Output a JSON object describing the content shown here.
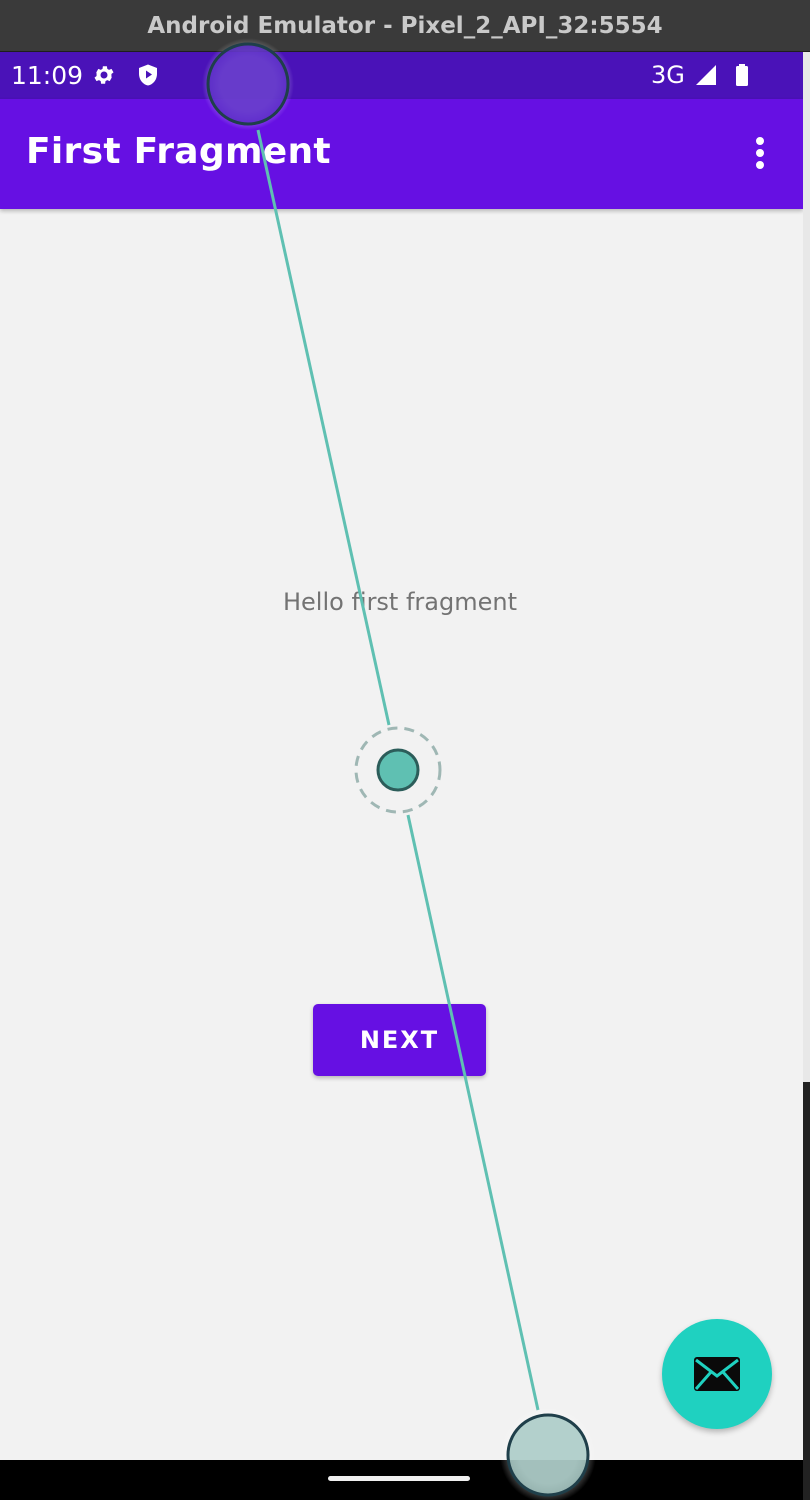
{
  "window": {
    "title": "Android Emulator - Pixel_2_API_32:5554"
  },
  "status_bar": {
    "time": "11:09",
    "network": "3G",
    "icons": [
      "settings-icon",
      "shield-play-icon",
      "signal-icon",
      "battery-icon"
    ]
  },
  "app_bar": {
    "title": "First Fragment",
    "menu_icon": "more-vert-icon"
  },
  "content": {
    "hello_text": "Hello first fragment",
    "next_label": "NEXT"
  },
  "fab": {
    "icon": "email-icon"
  },
  "colors": {
    "status_bar": "#4a12b8",
    "app_bar": "#6610e3",
    "button": "#6610e3",
    "fab": "#1fd1c0",
    "background": "#f2f2f2",
    "touch_indicator": "#5fc0b2"
  }
}
